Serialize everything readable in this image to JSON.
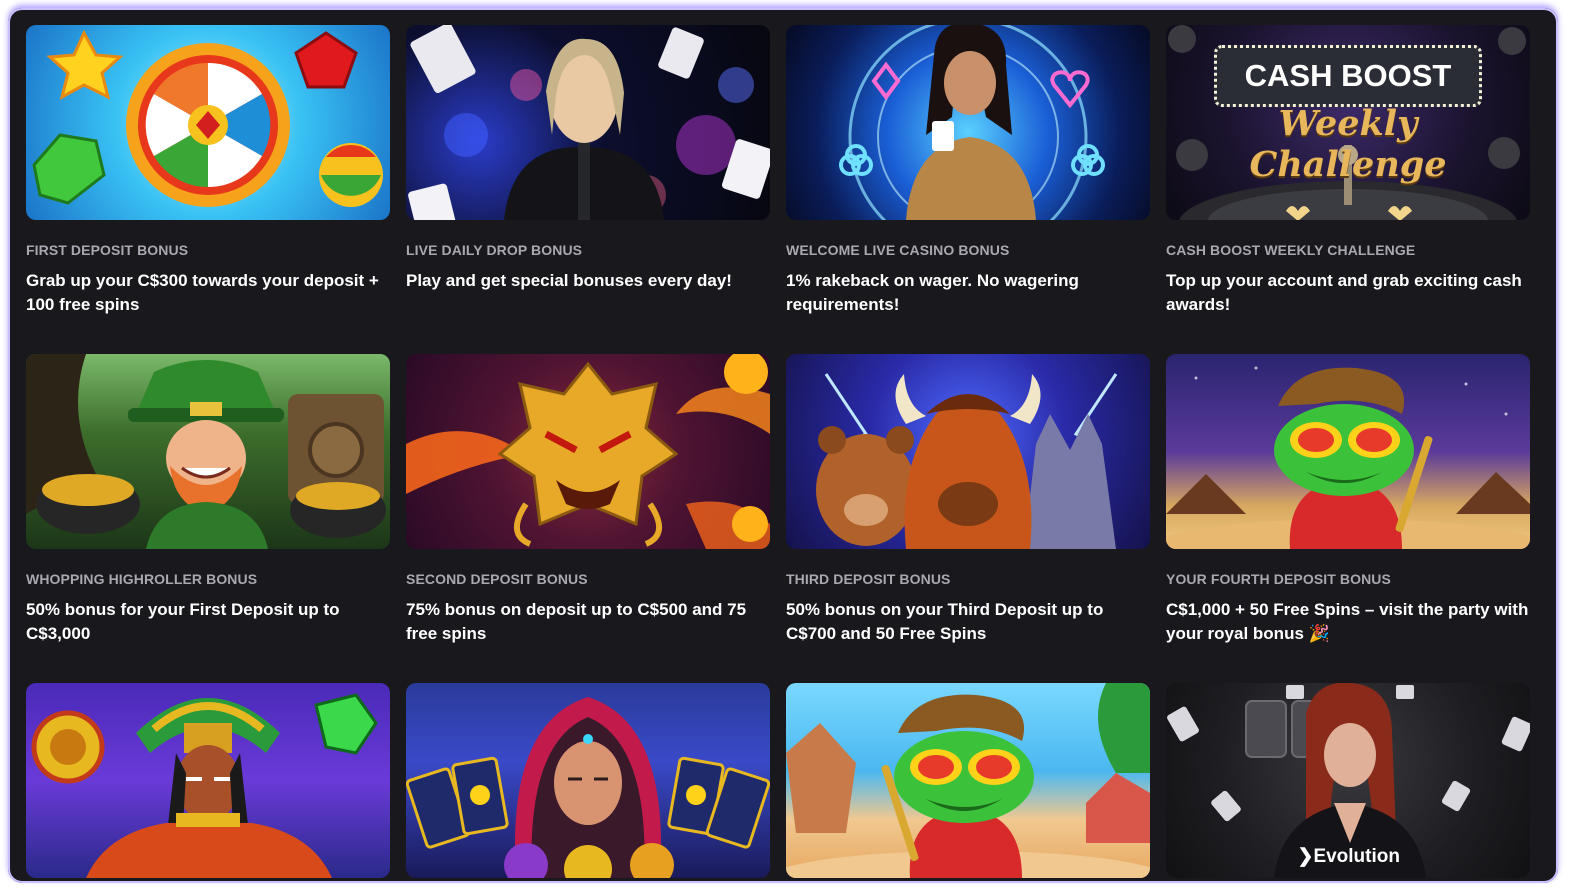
{
  "promotions": [
    {
      "title": "FIRST DEPOSIT BONUS",
      "description": "Grab up your C$300 towards your deposit + 100 free spins",
      "image": "gems-slot-art"
    },
    {
      "title": "LIVE DAILY DROP BONUS",
      "description": "Play and get special bonuses every day!",
      "image": "live-dealer-art"
    },
    {
      "title": "WELCOME LIVE CASINO BONUS",
      "description": "1% rakeback on wager. No wagering requirements!",
      "image": "live-casino-art"
    },
    {
      "title": "CASH BOOST WEEKLY CHALLENGE",
      "description": "Top up your account and grab exciting cash awards!",
      "image": "cash-boost-art",
      "banner": "CASH BOOST",
      "banner_sub": "Weekly Challenge"
    },
    {
      "title": "WHOPPING HIGHROLLER BONUS",
      "description": "50% bonus for your First Deposit up to C$3,000",
      "image": "leprechaun-art"
    },
    {
      "title": "SECOND DEPOSIT BONUS",
      "description": "75% bonus on deposit up to C$500 and 75 free spins",
      "image": "golden-dragon-art"
    },
    {
      "title": "THIRD DEPOSIT BONUS",
      "description": "50% bonus on your Third Deposit up to C$700 and 50 Free Spins",
      "image": "buffalo-wolf-bear-art"
    },
    {
      "title": "YOUR FOURTH DEPOSIT BONUS",
      "description": "C$1,000 + 50 Free Spins – visit the party with your royal bonus 🎉",
      "image": "frog-party-art"
    },
    {
      "title": "",
      "description": "",
      "image": "aztec-warrior-art"
    },
    {
      "title": "",
      "description": "",
      "image": "fortune-teller-art"
    },
    {
      "title": "",
      "description": "",
      "image": "frog-beach-art"
    },
    {
      "title": "",
      "description": "",
      "image": "evolution-dealer-art",
      "brand": "Evolution"
    }
  ],
  "colors": {
    "background": "#19181d",
    "title": "#a9a8b1",
    "description": "#ffffff",
    "frame_glow": "#c9c0ff"
  }
}
